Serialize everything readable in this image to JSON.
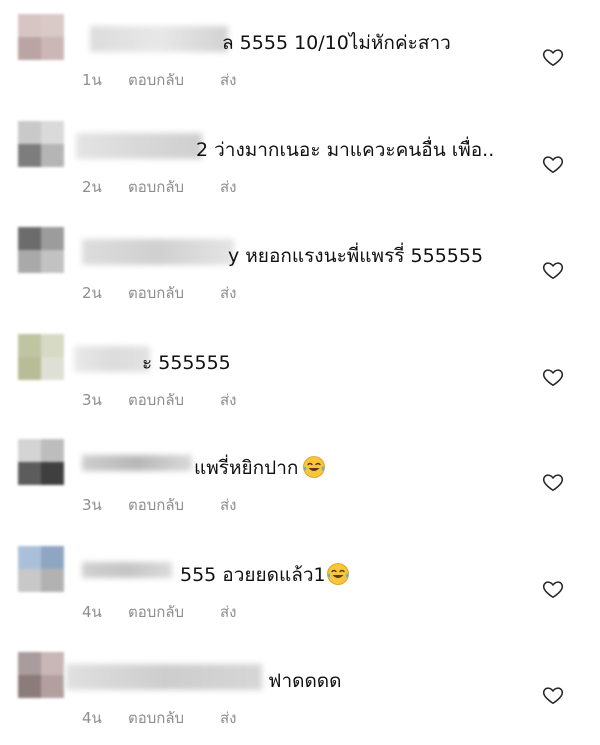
{
  "comments": [
    {
      "text": "ล 5555 10/10ไม่หักค่ะสาว",
      "time": "1น",
      "reply": "ตอบกลับ",
      "send": "ส่ง",
      "avatar_colors": [
        "#d7c5c5",
        "#d9c9c7",
        "#bba4a4",
        "#cbb7b5"
      ],
      "name_blur_colors": [
        "#dcdcdc",
        "#e8e8e8",
        "#d2d2d2"
      ]
    },
    {
      "text": "2 ว่างมากเนอะ มาแควะคนอื่น เพื่อ..",
      "time": "2น",
      "reply": "ตอบกลับ",
      "send": "ส่ง",
      "avatar_colors": [
        "#c9c9c9",
        "#dadada",
        "#7d7d7d",
        "#b5b5b5"
      ],
      "name_blur_colors": [
        "#e4e4e4",
        "#d8d8d8",
        "#cfcfcf"
      ]
    },
    {
      "text": "y หยอกแรงนะพี่แพรรี่ 555555",
      "time": "2น",
      "reply": "ตอบกลับ",
      "send": "ส่ง",
      "avatar_colors": [
        "#6c6c6c",
        "#9c9c9c",
        "#a9a9a9",
        "#c2c2c2"
      ],
      "name_blur_colors": [
        "#dddddd",
        "#cfcfcf",
        "#e5e5e5"
      ]
    },
    {
      "text": "ะ 555555",
      "time": "3น",
      "reply": "ตอบกลับ",
      "send": "ส่ง",
      "avatar_colors": [
        "#bfc4a2",
        "#d7dac5",
        "#b9bc97",
        "#dfe0d5"
      ],
      "name_blur_colors": [
        "#e9e9e9",
        "#dcdcdc",
        "#e2e2e2"
      ]
    },
    {
      "text": "แพรี่หยิกปาก",
      "time": "3น",
      "reply": "ตอบกลับ",
      "send": "ส่ง",
      "emoji": "😂",
      "avatar_colors": [
        "#d4d4d4",
        "#bdbdbd",
        "#5c5c5c",
        "#3f3f3f"
      ],
      "name_blur_colors": [
        "#cdcdcd",
        "#b7b7b7",
        "#d9d9d9"
      ]
    },
    {
      "text": "555 อวยยดแล้ว1",
      "time": "4น",
      "reply": "ตอบกลับ",
      "send": "ส่ง",
      "emoji": "😂",
      "avatar_colors": [
        "#aac0d9",
        "#8fa6c2",
        "#c8c8c8",
        "#b2b2b2"
      ],
      "name_blur_colors": [
        "#d0d0d0",
        "#c4c4c4",
        "#dadada"
      ]
    },
    {
      "text": "ฟาดดดด",
      "time": "4น",
      "reply": "ตอบกลับ",
      "send": "ส่ง",
      "avatar_colors": [
        "#a99c9c",
        "#c9b6b6",
        "#8c7b7b",
        "#b49f9f"
      ],
      "name_blur_colors": [
        "#e0e0e0",
        "#cdcdcd",
        "#d6d6d6"
      ]
    }
  ]
}
